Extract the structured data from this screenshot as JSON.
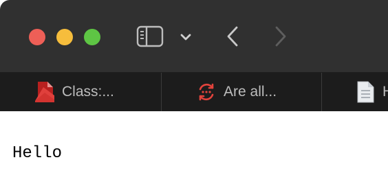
{
  "window": {
    "traffic_lights": {
      "close_color": "#ee5f57",
      "minimize_color": "#f6bd3c",
      "zoom_color": "#5ec544"
    }
  },
  "toolbar": {
    "sidebar_icon": "sidebar-icon",
    "chevron_icon": "chevron-down-icon",
    "back_icon": "back-arrow-icon",
    "forward_icon": "forward-arrow-icon",
    "forward_enabled": false
  },
  "tabs": [
    {
      "label": "Class:...",
      "icon": "pdf-document-icon"
    },
    {
      "label": "Are all...",
      "icon": "refresh-cycle-icon"
    },
    {
      "label": "H",
      "icon": "document-icon"
    }
  ],
  "content": {
    "text": "Hello"
  }
}
